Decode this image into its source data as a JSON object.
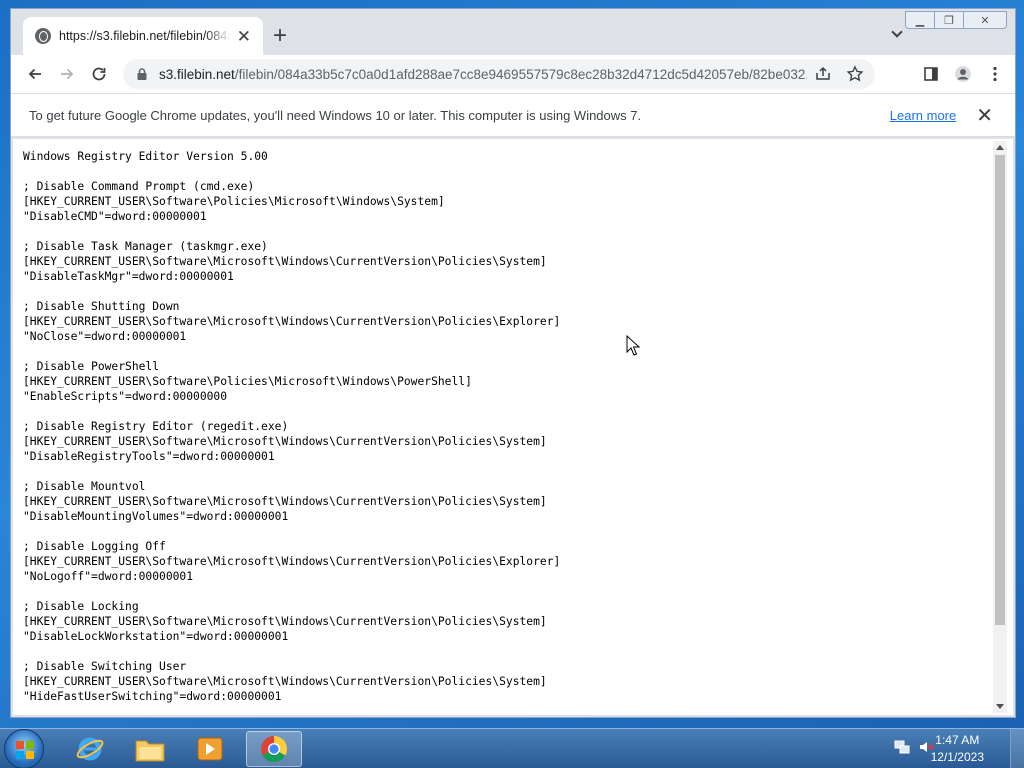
{
  "browser": {
    "tab": {
      "title": "https://s3.filebin.net/filebin/084a33b5c7c0a0d1afd288ae7cc8e9469557579c8ec28b32d4712dc5d42057eb/82be032..."
    },
    "address": {
      "host": "s3.filebin.net",
      "path": "/filebin/084a33b5c7c0a0d1afd288ae7cc8e9469557579c8ec28b32d4712dc5d42057eb/82be032..."
    },
    "infobar": {
      "message": "To get future Google Chrome updates, you'll need Windows 10 or later. This computer is using Windows 7.",
      "link": "Learn more"
    }
  },
  "document": {
    "text": "Windows Registry Editor Version 5.00\n\n; Disable Command Prompt (cmd.exe)\n[HKEY_CURRENT_USER\\Software\\Policies\\Microsoft\\Windows\\System]\n\"DisableCMD\"=dword:00000001\n\n; Disable Task Manager (taskmgr.exe)\n[HKEY_CURRENT_USER\\Software\\Microsoft\\Windows\\CurrentVersion\\Policies\\System]\n\"DisableTaskMgr\"=dword:00000001\n\n; Disable Shutting Down\n[HKEY_CURRENT_USER\\Software\\Microsoft\\Windows\\CurrentVersion\\Policies\\Explorer]\n\"NoClose\"=dword:00000001\n\n; Disable PowerShell\n[HKEY_CURRENT_USER\\Software\\Policies\\Microsoft\\Windows\\PowerShell]\n\"EnableScripts\"=dword:00000000\n\n; Disable Registry Editor (regedit.exe)\n[HKEY_CURRENT_USER\\Software\\Microsoft\\Windows\\CurrentVersion\\Policies\\System]\n\"DisableRegistryTools\"=dword:00000001\n\n; Disable Mountvol\n[HKEY_CURRENT_USER\\Software\\Microsoft\\Windows\\CurrentVersion\\Policies\\System]\n\"DisableMountingVolumes\"=dword:00000001\n\n; Disable Logging Off\n[HKEY_CURRENT_USER\\Software\\Microsoft\\Windows\\CurrentVersion\\Policies\\Explorer]\n\"NoLogoff\"=dword:00000001\n\n; Disable Locking\n[HKEY_CURRENT_USER\\Software\\Microsoft\\Windows\\CurrentVersion\\Policies\\System]\n\"DisableLockWorkstation\"=dword:00000001\n\n; Disable Switching User\n[HKEY_CURRENT_USER\\Software\\Microsoft\\Windows\\CurrentVersion\\Policies\\System]\n\"HideFastUserSwitching\"=dword:00000001"
  },
  "taskbar": {
    "apps": [
      {
        "icon": "internet-explorer-icon"
      },
      {
        "icon": "file-explorer-icon"
      },
      {
        "icon": "media-player-icon"
      },
      {
        "icon": "chrome-icon",
        "active": true
      }
    ],
    "clock": {
      "time": "1:47 AM",
      "date": "12/1/2023"
    }
  },
  "colors": {
    "accent": "#1a73e8",
    "taskbar": "#2a5a93"
  }
}
